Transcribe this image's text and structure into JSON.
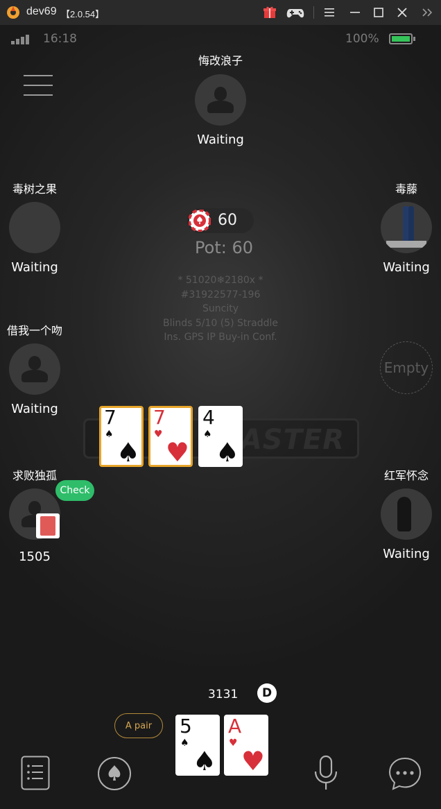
{
  "window": {
    "app_name": "dev69",
    "version": "【2.0.54】",
    "icons": [
      "gift-icon",
      "gamepad-icon",
      "hamburger-icon",
      "minimize-icon",
      "maximize-icon",
      "close-icon",
      "expand-icon"
    ]
  },
  "status_bar": {
    "time": "16:18",
    "battery_pct": "100%",
    "battery_level": 1.0
  },
  "seats": {
    "top": {
      "name": "悔改浪子",
      "status": "Waiting"
    },
    "left1": {
      "name": "毒树之果",
      "status": "Waiting"
    },
    "right1": {
      "name": "毒藤",
      "status": "Waiting"
    },
    "left2": {
      "name": "借我一个吻",
      "status": "Waiting"
    },
    "right2": {
      "label": "Empty"
    },
    "left3": {
      "name": "求败独孤",
      "stack": "1505",
      "action": "Check"
    },
    "right3": {
      "name": "红军怀念",
      "status": "Waiting"
    }
  },
  "pot": {
    "chip_value": "60",
    "label": "Pot: 60"
  },
  "table_info": {
    "line1": "* 51020❄2180x *",
    "line2": "#31922577-196",
    "line3": "Suncity",
    "line4": "Blinds 5/10 (5) Straddle",
    "line5": "Ins. GPS IP Buy-in Conf."
  },
  "watermark": "MASTER",
  "board": [
    {
      "rank": "7",
      "suit": "♠",
      "color": "black",
      "highlight": true
    },
    {
      "rank": "7",
      "suit": "♥",
      "color": "red",
      "highlight": true
    },
    {
      "rank": "4",
      "suit": "♠",
      "color": "black",
      "highlight": false
    }
  ],
  "hero": {
    "stack": "3131",
    "dealer_button": "D",
    "hand_name": "A pair",
    "cards": [
      {
        "rank": "5",
        "suit": "♠",
        "color": "black"
      },
      {
        "rank": "A",
        "suit": "♥",
        "color": "red"
      }
    ]
  },
  "bottom_bar": [
    "menu-list-icon",
    "spade-icon",
    "microphone-icon",
    "chat-icon"
  ],
  "colors": {
    "accent_gold": "#e7a52a",
    "check_green": "#2fbd6a",
    "card_red": "#d7303a",
    "battery_green": "#35c35a"
  }
}
